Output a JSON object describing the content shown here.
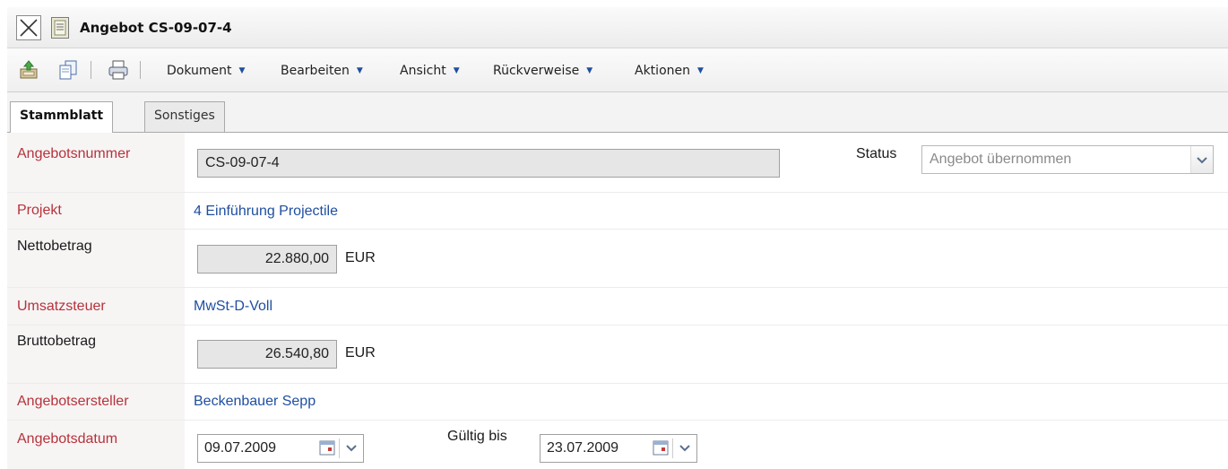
{
  "window": {
    "title": "Angebot CS-09-07-4"
  },
  "toolbar": {
    "icons": [
      "save-icon",
      "copy-icon",
      "print-icon"
    ],
    "menus": [
      {
        "label": "Dokument"
      },
      {
        "label": "Bearbeiten"
      },
      {
        "label": "Ansicht"
      },
      {
        "label": "Rückverweise"
      },
      {
        "label": "Aktionen"
      }
    ]
  },
  "tabs": [
    {
      "label": "Stammblatt",
      "active": true
    },
    {
      "label": "Sonstiges",
      "active": false
    }
  ],
  "form": {
    "angebotsnummer": {
      "label": "Angebotsnummer",
      "value": "CS-09-07-4"
    },
    "status": {
      "label": "Status",
      "value": "Angebot übernommen"
    },
    "projekt": {
      "label": "Projekt",
      "value": "4 Einführung Projectile"
    },
    "nettobetrag": {
      "label": "Nettobetrag",
      "value": "22.880,00",
      "unit": "EUR"
    },
    "umsatzsteuer": {
      "label": "Umsatzsteuer",
      "value": "MwSt-D-Voll"
    },
    "bruttobetrag": {
      "label": "Bruttobetrag",
      "value": "26.540,80",
      "unit": "EUR"
    },
    "angebotsersteller": {
      "label": "Angebotsersteller",
      "value": "Beckenbauer Sepp"
    },
    "angebotsdatum": {
      "label": "Angebotsdatum",
      "value": "09.07.2009"
    },
    "gueltig_bis": {
      "label": "Gültig bis",
      "value": "23.07.2009"
    }
  },
  "colors": {
    "required_label": "#b5333b",
    "link": "#1f4fa0"
  }
}
